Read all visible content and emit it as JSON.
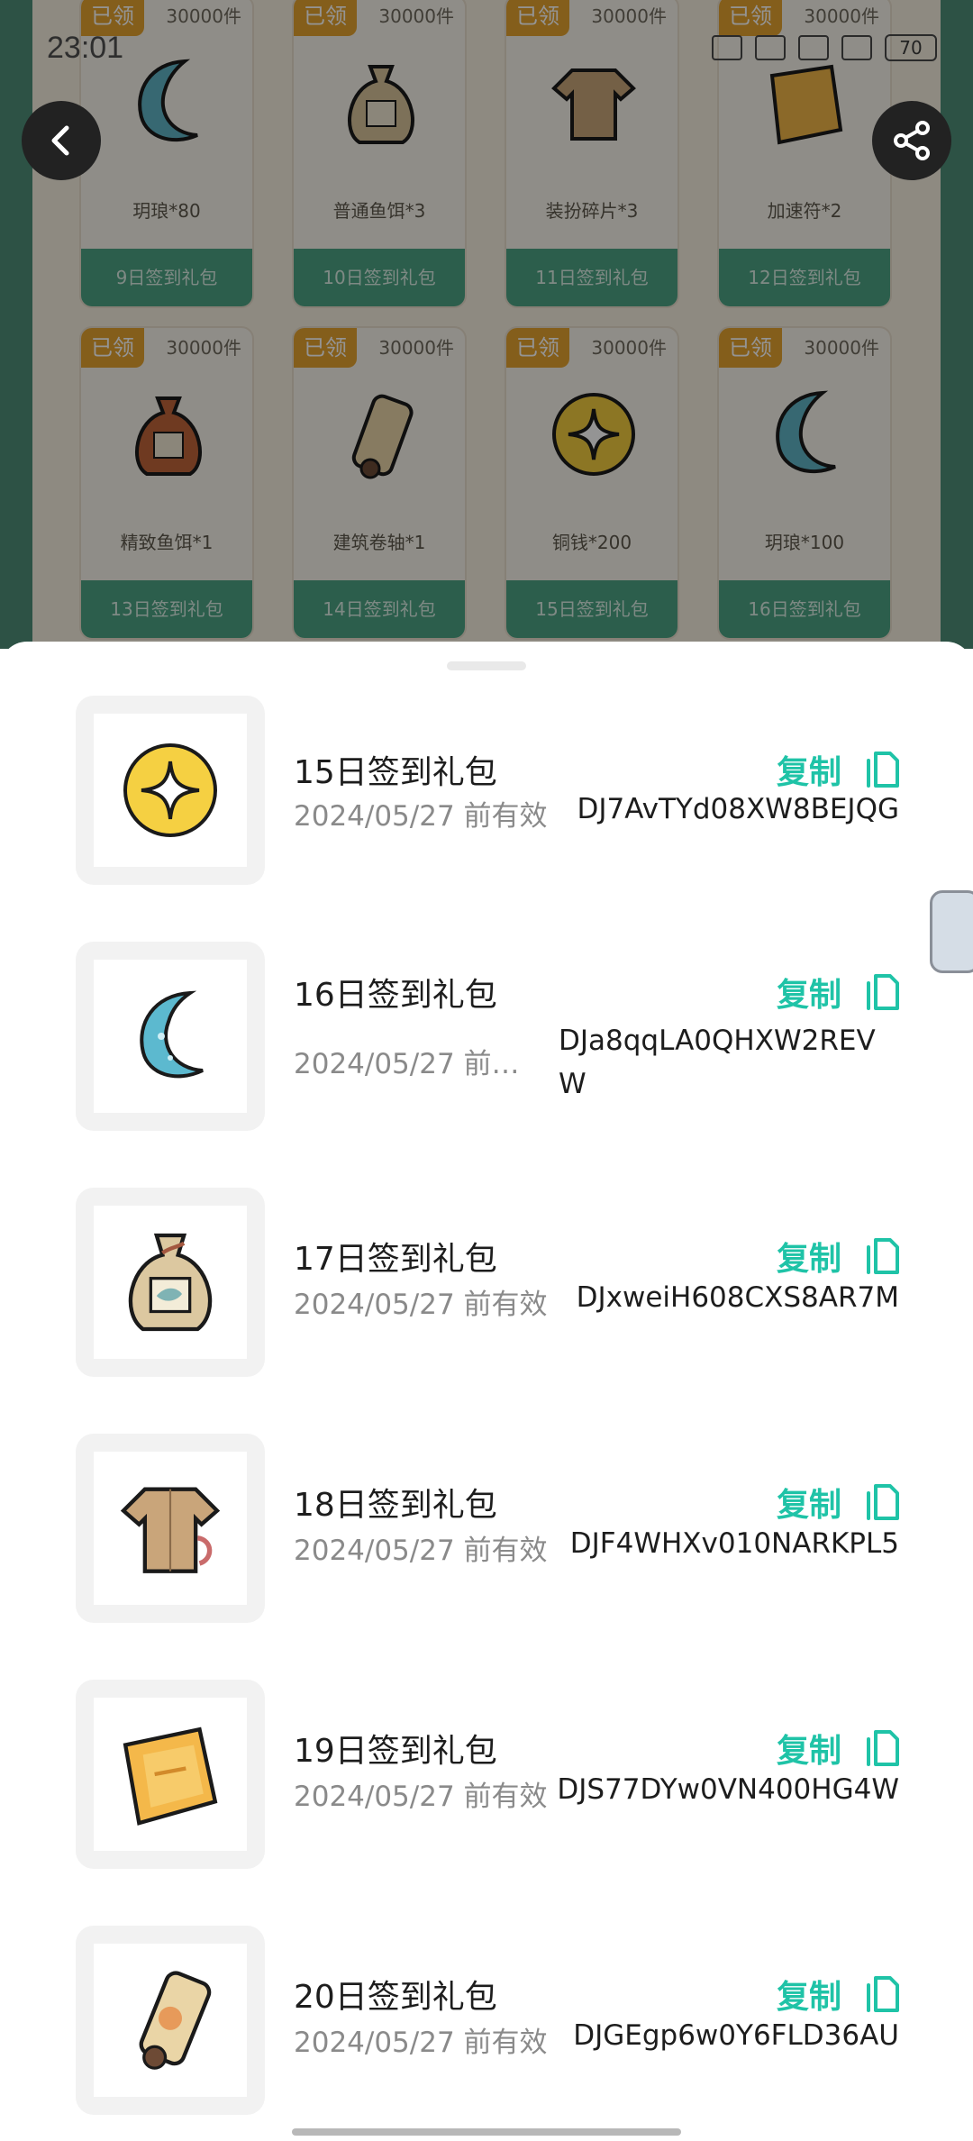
{
  "status": {
    "time": "23:01",
    "battery": "70"
  },
  "background_cards": [
    {
      "tag": "已领",
      "stock": "30000件",
      "name": "玥琅*80",
      "button": "9日签到礼包",
      "icon": "moon"
    },
    {
      "tag": "已领",
      "stock": "30000件",
      "name": "普通鱼饵*3",
      "button": "10日签到礼包",
      "icon": "fish-bag"
    },
    {
      "tag": "已领",
      "stock": "30000件",
      "name": "装扮碎片*3",
      "button": "11日签到礼包",
      "icon": "shirt"
    },
    {
      "tag": "已领",
      "stock": "30000件",
      "name": "加速符*2",
      "button": "12日签到礼包",
      "icon": "scroll-flat"
    },
    {
      "tag": "已领",
      "stock": "30000件",
      "name": "精致鱼饵*1",
      "button": "13日签到礼包",
      "icon": "fish-bag-red"
    },
    {
      "tag": "已领",
      "stock": "30000件",
      "name": "建筑卷轴*1",
      "button": "14日签到礼包",
      "icon": "scroll-roll"
    },
    {
      "tag": "已领",
      "stock": "30000件",
      "name": "铜钱*200",
      "button": "15日签到礼包",
      "icon": "coin"
    },
    {
      "tag": "已领",
      "stock": "30000件",
      "name": "玥琅*100",
      "button": "16日签到礼包",
      "icon": "moon"
    }
  ],
  "gifts": [
    {
      "title": "15日签到礼包",
      "expiry": "2024/05/27 前有效",
      "code": "DJ7AvTYd08XW8BEJQG",
      "copy": "复制",
      "icon": "coin"
    },
    {
      "title": "16日签到礼包",
      "expiry": "2024/05/27 前…",
      "code": "DJa8qqLA0QHXW2REVW",
      "copy": "复制",
      "icon": "moon"
    },
    {
      "title": "17日签到礼包",
      "expiry": "2024/05/27 前有效",
      "code": "DJxweiH608CXS8AR7M",
      "copy": "复制",
      "icon": "fish-bag"
    },
    {
      "title": "18日签到礼包",
      "expiry": "2024/05/27 前有效",
      "code": "DJF4WHXv010NARKPL5",
      "copy": "复制",
      "icon": "shirt"
    },
    {
      "title": "19日签到礼包",
      "expiry": "2024/05/27 前有效",
      "code": "DJS77DYw0VN400HG4W",
      "copy": "复制",
      "icon": "scroll-flat"
    },
    {
      "title": "20日签到礼包",
      "expiry": "2024/05/27 前有效",
      "code": "DJGEgp6w0Y6FLD36AU",
      "copy": "复制",
      "icon": "scroll-roll"
    }
  ],
  "colors": {
    "accent": "#1fc3a7",
    "background_green": "#4f8e78",
    "tag_orange": "#e3a22f"
  }
}
